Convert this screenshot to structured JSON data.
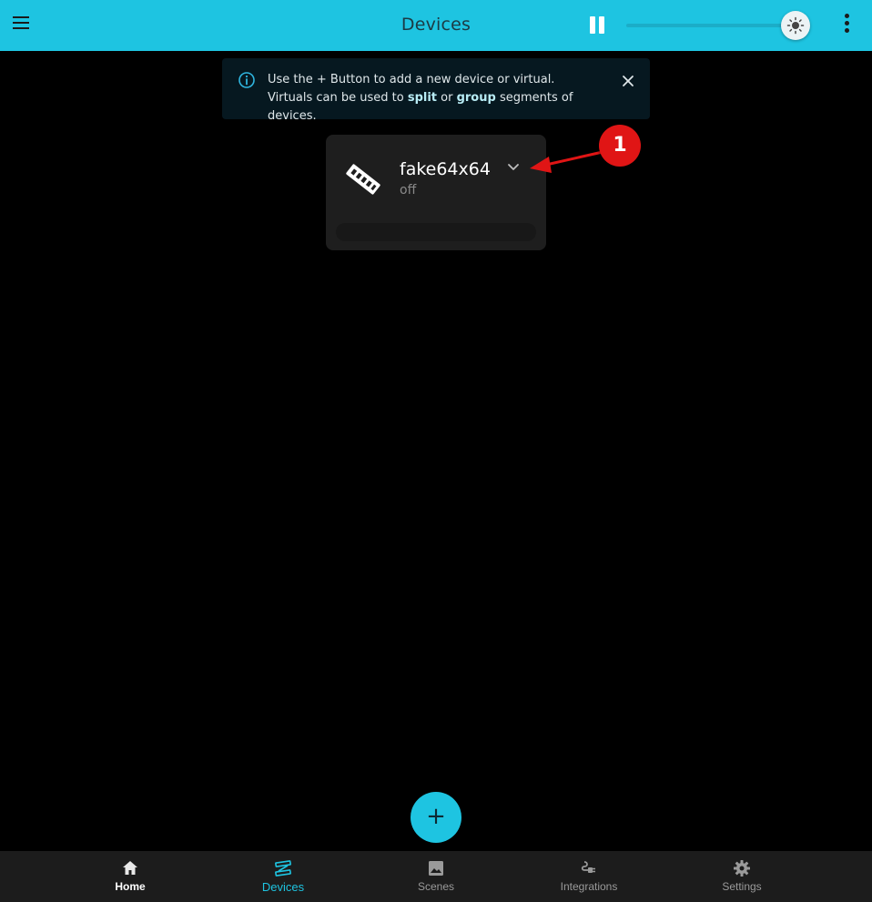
{
  "header": {
    "title": "Devices",
    "brightness_level": 0.98,
    "accent_color": "#1ec4e1"
  },
  "info_banner": {
    "line1": "Use the + Button to add a new device or virtual.",
    "line2_prefix": "Virtuals can be used to ",
    "line2_bold1": "split",
    "line2_mid": " or ",
    "line2_bold2": "group",
    "line2_suffix": " segments of devices."
  },
  "devices": [
    {
      "name": "fake64x64",
      "status": "off"
    }
  ],
  "annotation": {
    "number": "1",
    "color": "#e01515"
  },
  "fab": {
    "label": "+"
  },
  "bottom_nav": [
    {
      "label": "Home",
      "icon": "home-icon"
    },
    {
      "label": "Devices",
      "icon": "devices-icon",
      "active": true
    },
    {
      "label": "Scenes",
      "icon": "image-icon"
    },
    {
      "label": "Integrations",
      "icon": "plug-icon"
    },
    {
      "label": "Settings",
      "icon": "gear-icon"
    }
  ]
}
